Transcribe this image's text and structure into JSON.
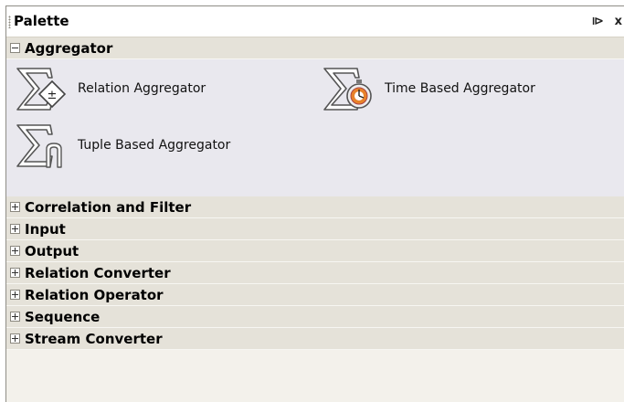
{
  "palette": {
    "title": "Palette",
    "minimize_label": "⧐",
    "close_label": "x"
  },
  "categories": [
    {
      "label": "Aggregator",
      "expanded": true,
      "items": [
        {
          "label": "Relation Aggregator",
          "icon": "sigma-relation-icon"
        },
        {
          "label": "Time Based Aggregator",
          "icon": "sigma-time-icon"
        },
        {
          "label": "Tuple Based Aggregator",
          "icon": "sigma-tuple-icon"
        }
      ]
    },
    {
      "label": "Correlation and Filter",
      "expanded": false
    },
    {
      "label": "Input",
      "expanded": false
    },
    {
      "label": "Output",
      "expanded": false
    },
    {
      "label": "Relation Converter",
      "expanded": false
    },
    {
      "label": "Relation Operator",
      "expanded": false
    },
    {
      "label": "Sequence",
      "expanded": false
    },
    {
      "label": "Stream Converter",
      "expanded": false
    }
  ]
}
